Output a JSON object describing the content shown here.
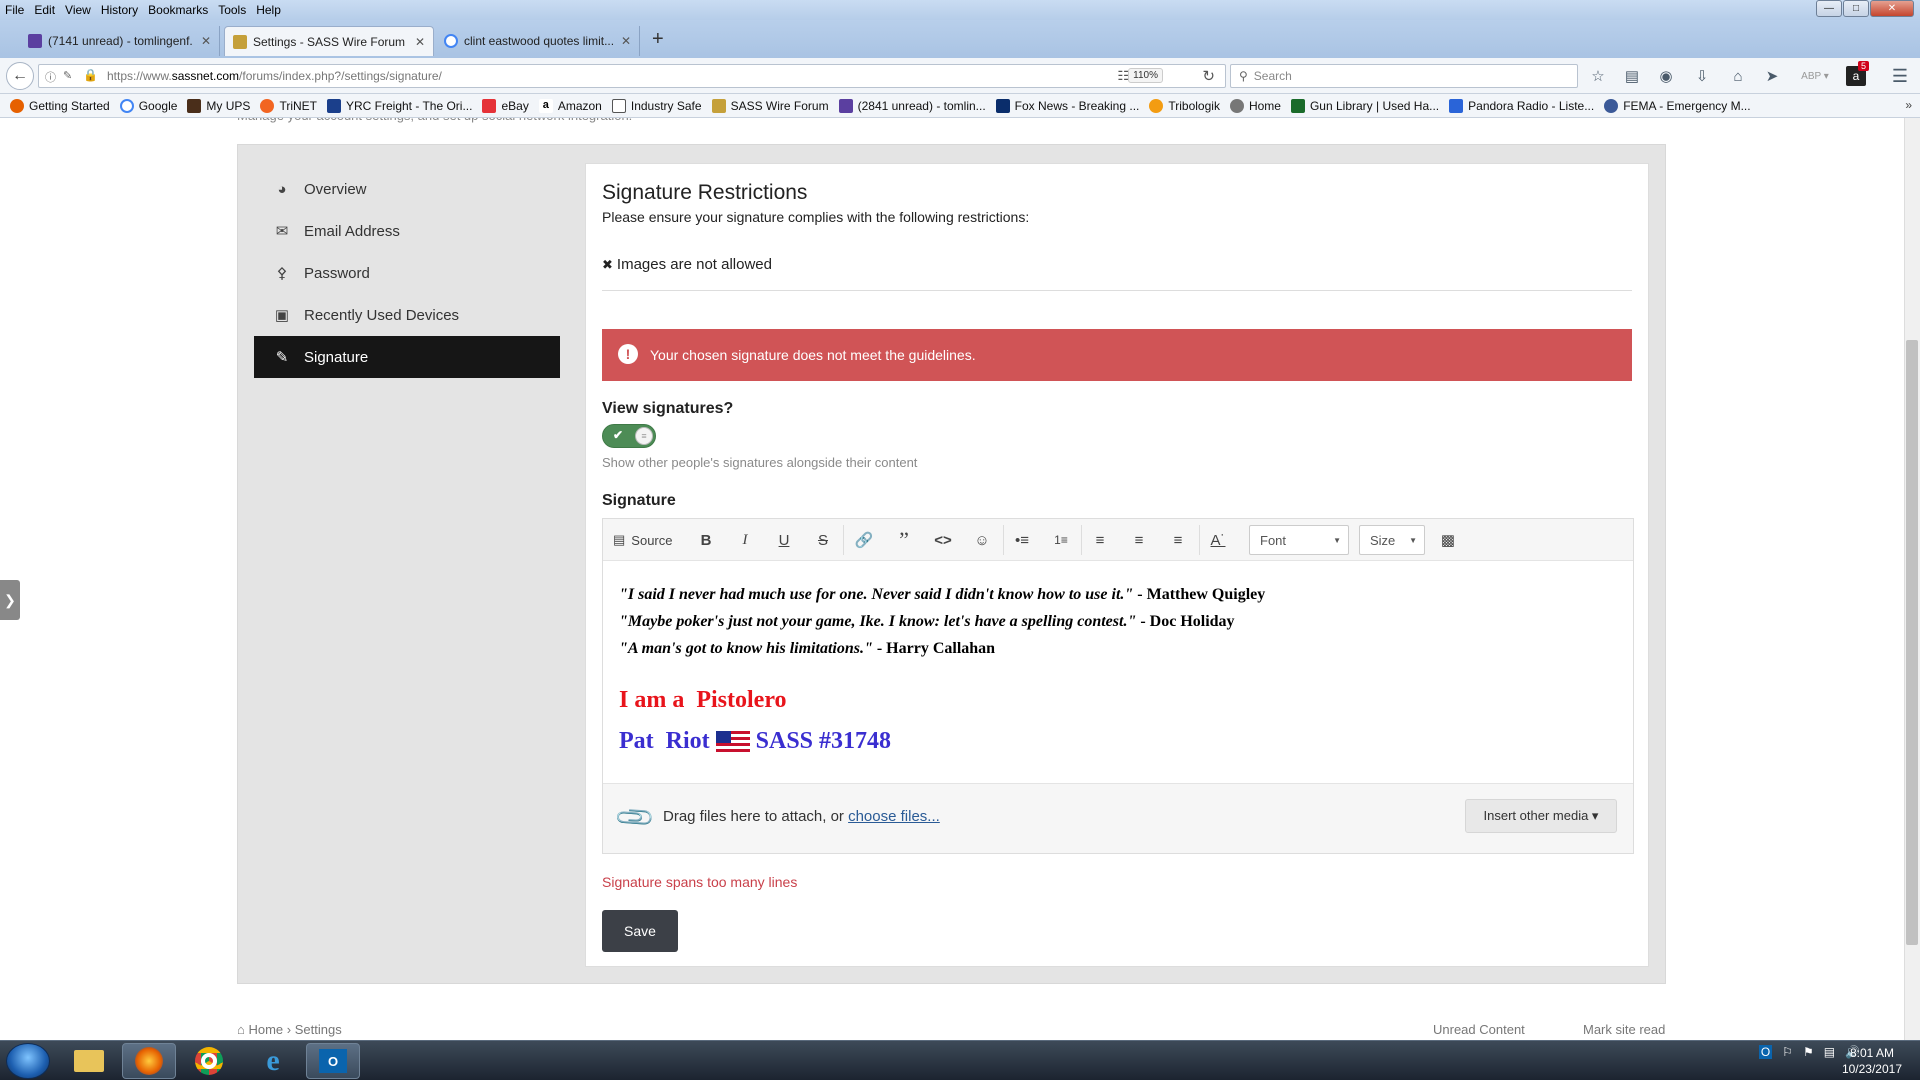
{
  "browser": {
    "menu": [
      "File",
      "Edit",
      "View",
      "History",
      "Bookmarks",
      "Tools",
      "Help"
    ],
    "tabs": [
      {
        "label": "(7141 unread) - tomlingenf...",
        "active": false
      },
      {
        "label": "Settings - SASS Wire Forum",
        "active": true
      },
      {
        "label": "clint eastwood quotes limit...",
        "active": false
      }
    ],
    "url_prefix": "https://www.",
    "url_domain": "sassnet.com",
    "url_path": "/forums/index.php?/settings/signature/",
    "zoom": "110%",
    "search_placeholder": "Search",
    "badge": "5",
    "bookmarks": [
      "Getting Started",
      "Google",
      "My UPS",
      "TriNET",
      "YRC Freight - The Ori...",
      "eBay",
      "Amazon",
      "Industry Safe",
      "SASS Wire Forum",
      "(2841 unread) - tomlin...",
      "Fox News - Breaking ...",
      "Tribologik",
      "Home",
      "Gun Library | Used Ha...",
      "Pandora Radio - Liste...",
      "FEMA - Emergency M..."
    ]
  },
  "sidebar": {
    "items": [
      {
        "label": "Overview",
        "icon": "dashboard-icon"
      },
      {
        "label": "Email Address",
        "icon": "envelope-icon"
      },
      {
        "label": "Password",
        "icon": "key-icon"
      },
      {
        "label": "Recently Used Devices",
        "icon": "laptop-icon"
      },
      {
        "label": "Signature",
        "icon": "pencil-icon",
        "active": true
      }
    ]
  },
  "content": {
    "title": "Signature Restrictions",
    "subtitle": "Please ensure your signature complies with the following restrictions:",
    "restriction_mark": "✖",
    "restriction": "Images are not allowed",
    "error_banner": "Your chosen signature does not meet the guidelines.",
    "view_label": "View signatures?",
    "view_hint": "Show other people's signatures alongside their content",
    "view_on": true,
    "signature_label": "Signature",
    "toolbar": {
      "source": "Source",
      "font": "Font",
      "size": "Size"
    },
    "signature": {
      "q1": "\"I said I never had much use for one. Never said I didn't know how to use it.\"",
      "a1": " - Matthew Quigley",
      "q2": "\"Maybe poker's just not your game, Ike. I know: let's have a spelling contest.\"",
      "a2": " - Doc Holiday",
      "q3": "\"A man's got to know his limitations.\"",
      "a3": " - Harry Callahan",
      "line4": "I am a  Pistolero",
      "line5a": "Pat  Riot",
      "line5b": "SASS #31748"
    },
    "attach_text": "Drag files here to attach, or ",
    "attach_link": "choose files...",
    "insert_media": "Insert other media ▾",
    "field_error": "Signature spans too many lines",
    "save": "Save"
  },
  "footer": {
    "home": "Home",
    "sep": "›",
    "settings": "Settings",
    "unread": "Unread Content",
    "mark": "Mark site read"
  },
  "taskbar": {
    "time": "8:01 AM",
    "date": "10/23/2017"
  },
  "colors": {
    "error": "#d05456",
    "accent": "#4d8c56",
    "save": "#3c4047",
    "sig_red": "#e8141b",
    "sig_blue": "#3a2ed0"
  }
}
